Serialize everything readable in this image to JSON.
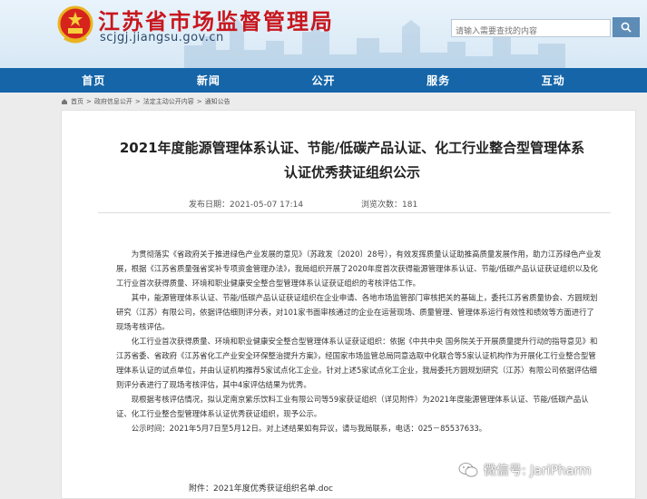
{
  "header": {
    "site_name": "江苏省市场监督管理局",
    "domain": "scjgj.jiangsu.gov.cn",
    "search_placeholder": "请输入需要查找的内容"
  },
  "nav": [
    "首页",
    "新闻",
    "公开",
    "服务",
    "互动"
  ],
  "breadcrumb": [
    "首页",
    "政府信息公开",
    "法定主动公开内容",
    "通知公告"
  ],
  "article": {
    "title": "2021年度能源管理体系认证、节能/低碳产品认证、化工行业整合型管理体系认证优秀获证组织公示",
    "published": "发布日期：2021-05-07 17:14",
    "views": "浏览次数：181",
    "paragraphs": [
      "为贯彻落实《省政府关于推进绿色产业发展的意见》（苏政发〔2020〕28号），有效发挥质量认证助推高质量发展作用，助力江苏绿色产业发展，根据《江苏省质量强省奖补专项资金管理办法》，我局组织开展了2020年度首次获得能源管理体系认证、节能/低碳产品认证获证组织以及化工行业首次获得质量、环境和职业健康安全整合型管理体系认证获证组织的考核评估工作。",
      "其中，能源管理体系认证、节能/低碳产品认证获证组织在企业申请、各地市场监管部门审核把关的基础上，委托江苏省质量协会、方圆规划研究（江苏）有限公司，依据评估细则评分表，对101家书面审核通过的企业在运营现场、质量管理、管理体系运行有效性和绩效等方面进行了现场考核评估。",
      "化工行业首次获得质量、环境和职业健康安全整合型管理体系认证获证组织：依据《中共中央 国务院关于开展质量提升行动的指导意见》和江苏省委、省政府《江苏省化工产业安全环保整治提升方案》，经国家市场监管总局同意选取中化联合等5家认证机构作为开展化工行业整合型管理体系认证的试点单位，并由认证机构推荐5家试点化工企业。针对上述5家试点化工企业，我局委托方圆规划研究（江苏）有限公司依据评估细则评分表进行了现场考核评估，其中4家评估结果为优秀。",
      "现根据考核评估情况，拟认定南京紫乐饮料工业有限公司等59家获证组织（详见附件）为2021年度能源管理体系认证、节能/低碳产品认证、化工行业整合型管理体系认证优秀获证组织，现予公示。",
      "公示时间：2021年5月7日至5月12日。对上述结果如有异议，请与我局联系，电话：025－85537633。"
    ],
    "attachment": "附件：2021年度优秀获证组织名单.doc"
  },
  "watermark": "微信号: JariPharm"
}
